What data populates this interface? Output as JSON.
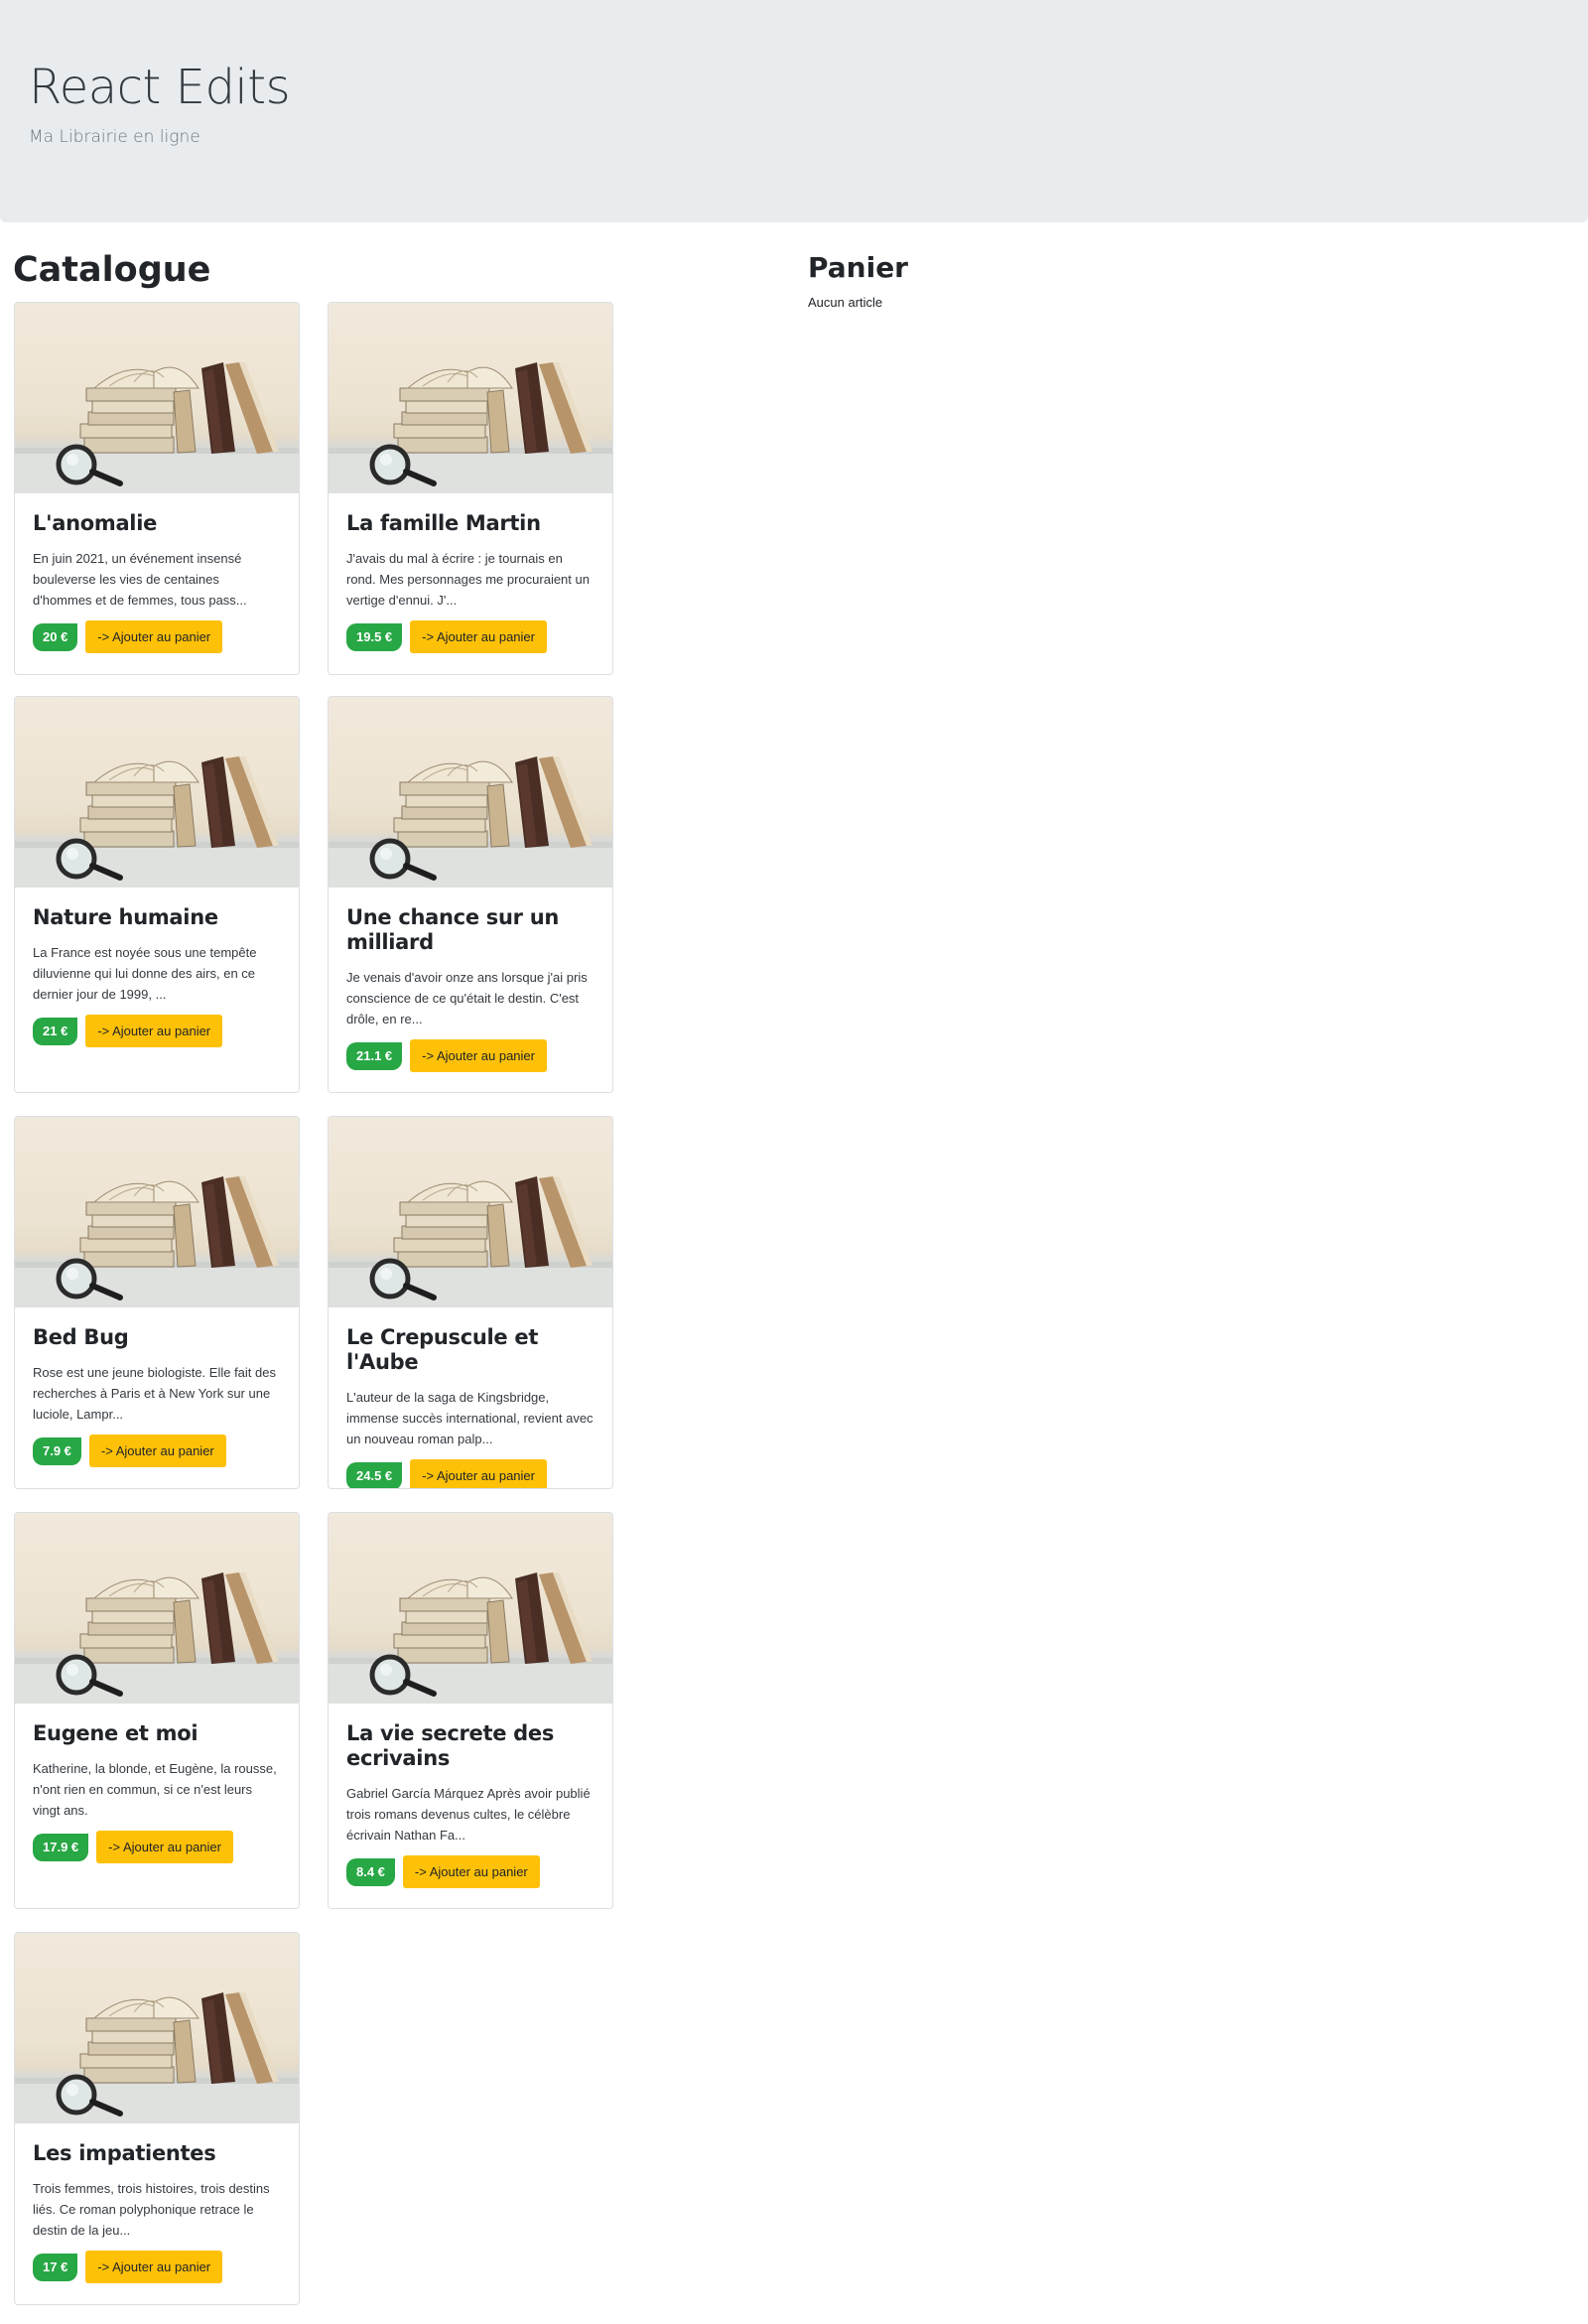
{
  "header": {
    "title": "React Edits",
    "subtitle": "Ma Librairie en ligne"
  },
  "catalogue": {
    "title": "Catalogue",
    "add_label": "-> Ajouter au panier",
    "books": [
      {
        "title": "L'anomalie",
        "description": "En juin 2021, un événement insensé bouleverse les vies de centaines d'hommes et de femmes, tous pass...",
        "price": "20 €"
      },
      {
        "title": "La famille Martin",
        "description": "J'avais du mal à écrire : je tournais en rond. Mes personnages me procuraient un vertige d'ennui. J'...",
        "price": "19.5 €"
      },
      {
        "title": "Nature humaine",
        "description": "La France est noyée sous une tempête diluvienne qui lui donne des airs, en ce dernier jour de 1999, ...",
        "price": "21 €"
      },
      {
        "title": "Une chance sur un milliard",
        "description": "Je venais d'avoir onze ans lorsque j'ai pris conscience de ce qu'était le destin. C'est drôle, en re...",
        "price": "21.1 €"
      },
      {
        "title": "Bed Bug",
        "description": "Rose est une jeune biologiste. Elle fait des recherches à Paris et à New York sur une luciole, Lampr...",
        "price": "7.9 €"
      },
      {
        "title": "Le Crepuscule et l'Aube",
        "description": "L'auteur de la saga de Kingsbridge, immense succès international, revient avec un nouveau roman palp...",
        "price": "24.5 €"
      },
      {
        "title": "Eugene et moi",
        "description": "Katherine, la blonde, et Eugène, la rousse, n'ont rien en commun, si ce n'est leurs vingt ans.",
        "price": "17.9 €"
      },
      {
        "title": "La vie secrete des ecrivains",
        "description": "Gabriel García Márquez Après avoir publié trois romans devenus cultes, le célèbre écrivain Nathan Fa...",
        "price": "8.4 €"
      },
      {
        "title": "Les impatientes",
        "description": "Trois femmes, trois histoires, trois destins liés. Ce roman polyphonique retrace le destin de la jeu...",
        "price": "17 €"
      }
    ]
  },
  "cart": {
    "title": "Panier",
    "empty_text": "Aucun article"
  },
  "colors": {
    "price_badge": "#28a745",
    "add_button": "#ffc107",
    "header_bg": "#e9ecef"
  },
  "icons": {
    "book_image": "books-with-magnifier-photo"
  }
}
